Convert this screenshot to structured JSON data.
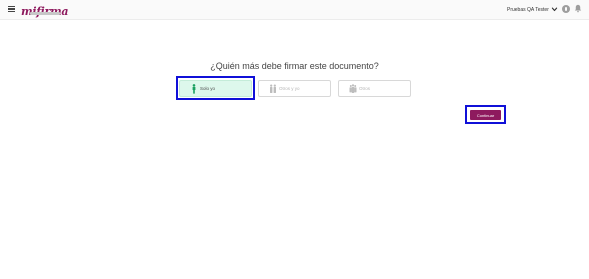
{
  "header": {
    "logo_text": "mifirma",
    "user_name": "Pruebas QA Tester"
  },
  "main": {
    "question": "¿Quién más debe firmar este documento?",
    "options": [
      {
        "label": "Solo yo",
        "selected": true
      },
      {
        "label": "Otros y yo",
        "selected": false
      },
      {
        "label": "Otros",
        "selected": false
      }
    ],
    "continue_label": "Continuar"
  },
  "colors": {
    "brand": "#8e1a5e",
    "selected_bg": "#ddf8ec",
    "selected_icon": "#1aa060",
    "annotation_outline": "#1010d8"
  },
  "icons": {
    "menu": "hamburger-icon",
    "chevron": "chevron-down-icon",
    "avatar": "user-avatar-icon",
    "bell": "bell-icon",
    "solo": "person-icon",
    "others_and_me": "two-persons-icon",
    "others": "group-icon"
  }
}
